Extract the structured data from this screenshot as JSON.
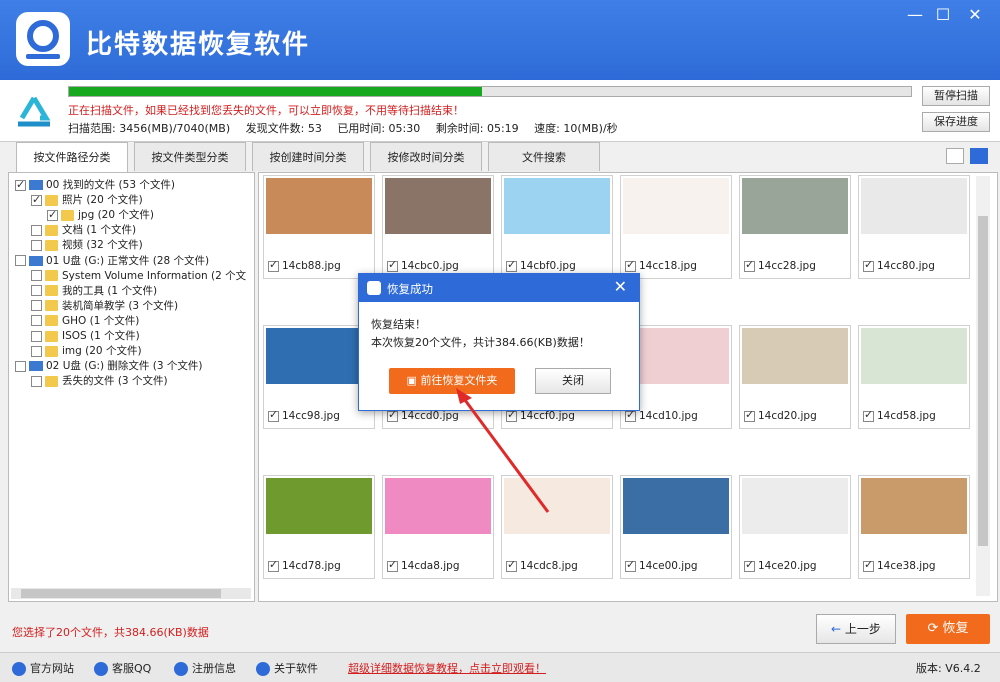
{
  "app": {
    "title": "比特数据恢复软件"
  },
  "window": {
    "minimize": "—",
    "maximize": "☐",
    "close": "✕"
  },
  "scan": {
    "progress": 0.49,
    "message": "正在扫描文件，如果已经找到您丢失的文件，可以立即恢复，不用等待扫描结束！",
    "info": [
      "扫描范围: 3456(MB)/7040(MB)",
      "发现文件数: 53",
      "已用时间: 05:30",
      "剩余时间: 05:19",
      "速度: 10(MB)/秒"
    ],
    "pause_label": "暂停扫描",
    "save_label": "保存进度"
  },
  "tabs": [
    "按文件路径分类",
    "按文件类型分类",
    "按创建时间分类",
    "按修改时间分类",
    "文件搜索"
  ],
  "tree": [
    {
      "label": "00 找到的文件 (53 个文件)",
      "level": 0,
      "checked": true,
      "icon": "drive"
    },
    {
      "label": "照片    (20 个文件)",
      "level": 1,
      "checked": true,
      "icon": "folder"
    },
    {
      "label": "jpg    (20 个文件)",
      "level": 2,
      "checked": true,
      "icon": "folder"
    },
    {
      "label": "文档    (1 个文件)",
      "level": 1,
      "checked": false,
      "icon": "folder"
    },
    {
      "label": "视频    (32 个文件)",
      "level": 1,
      "checked": false,
      "icon": "folder"
    },
    {
      "label": "01 U盘 (G:) 正常文件 (28 个文件)",
      "level": 0,
      "checked": false,
      "icon": "drive"
    },
    {
      "label": "System Volume Information   (2 个文",
      "level": 1,
      "checked": false,
      "icon": "folder"
    },
    {
      "label": "我的工具    (1 个文件)",
      "level": 1,
      "checked": false,
      "icon": "folder"
    },
    {
      "label": "装机简单教学    (3 个文件)",
      "level": 1,
      "checked": false,
      "icon": "folder"
    },
    {
      "label": "GHO    (1 个文件)",
      "level": 1,
      "checked": false,
      "icon": "folder"
    },
    {
      "label": "ISOS    (1 个文件)",
      "level": 1,
      "checked": false,
      "icon": "folder"
    },
    {
      "label": "img    (20 个文件)",
      "level": 1,
      "checked": false,
      "icon": "folder"
    },
    {
      "label": "02 U盘 (G:) 删除文件 (3 个文件)",
      "level": 0,
      "checked": false,
      "icon": "drive"
    },
    {
      "label": "丢失的文件    (3 个文件)",
      "level": 1,
      "checked": false,
      "icon": "folder"
    }
  ],
  "files": [
    {
      "name": "14cb88.jpg",
      "color": "#c98a5a"
    },
    {
      "name": "14cbc0.jpg",
      "color": "#8a7468"
    },
    {
      "name": "14cbf0.jpg",
      "color": "#9bd3f0"
    },
    {
      "name": "14cc18.jpg",
      "color": "#f7f2ee"
    },
    {
      "name": "14cc28.jpg",
      "color": "#9aa59a"
    },
    {
      "name": "14cc80.jpg",
      "color": "#e9e9ea"
    },
    {
      "name": "14cc98.jpg",
      "color": "#2f6fb1"
    },
    {
      "name": "14ccd0.jpg",
      "color": "#d8d8d8"
    },
    {
      "name": "14ccf0.jpg",
      "color": "#e8e3dd"
    },
    {
      "name": "14cd10.jpg",
      "color": "#f0cfd3"
    },
    {
      "name": "14cd20.jpg",
      "color": "#d8cbb6"
    },
    {
      "name": "14cd58.jpg",
      "color": "#d8e4d4"
    },
    {
      "name": "14cd78.jpg",
      "color": "#6e9a2e"
    },
    {
      "name": "14cda8.jpg",
      "color": "#f08ac3"
    },
    {
      "name": "14cdc8.jpg",
      "color": "#f5e9e0"
    },
    {
      "name": "14ce00.jpg",
      "color": "#3b6ea5"
    },
    {
      "name": "14ce20.jpg",
      "color": "#ececec"
    },
    {
      "name": "14ce38.jpg",
      "color": "#c99a6a"
    }
  ],
  "footer": {
    "selection": "您选择了20个文件，共384.66(KB)数据",
    "prev_label": "上一步",
    "recover_label": "恢复",
    "links": [
      "官方网站",
      "客服QQ",
      "注册信息",
      "关于软件"
    ],
    "tutorial": "超级详细数据恢复教程，点击立即观看！",
    "version": "版本: V6.4.2"
  },
  "dialog": {
    "title": "恢复成功",
    "line1": "恢复结束！",
    "line2": "本次恢复20个文件，共计384.66(KB)数据！",
    "open_label": "前往恢复文件夹",
    "close_label": "关闭"
  },
  "colors": {
    "accent": "#2e6bd8",
    "orange": "#f26b1d",
    "progress": "#18a81f",
    "warning": "#d21e1e"
  }
}
